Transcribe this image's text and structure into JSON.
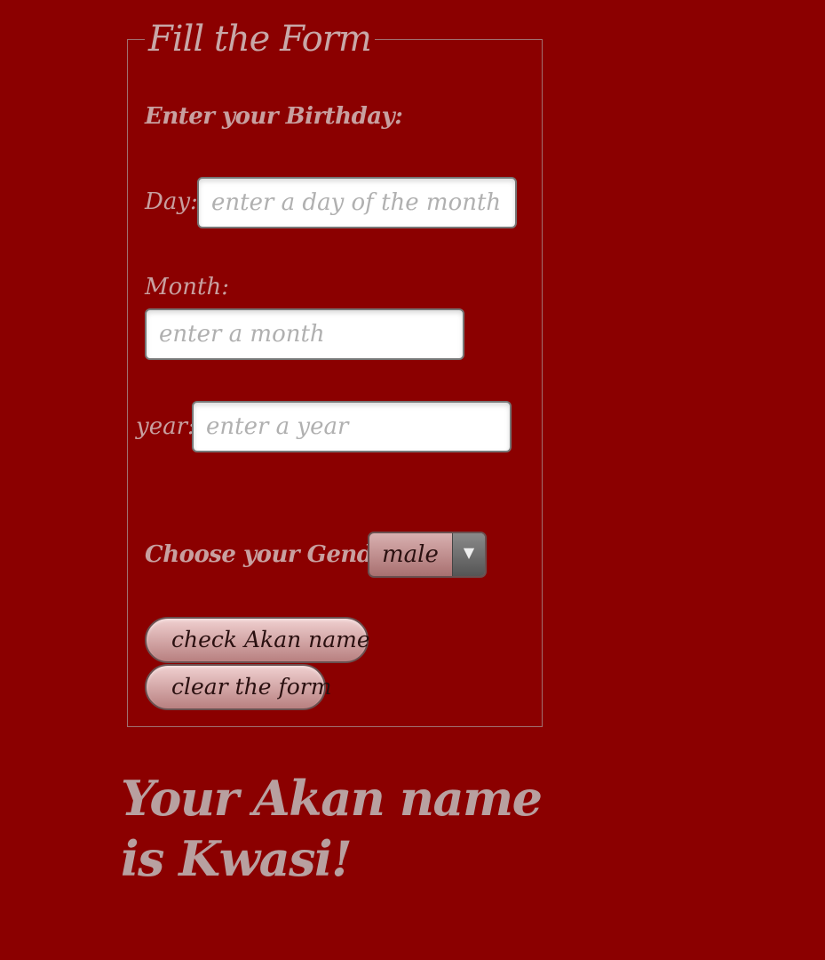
{
  "form": {
    "legend": "Fill the Form",
    "birthday_heading": "Enter your Birthday:",
    "day_label": "Day:",
    "day_placeholder": "enter a day of the month",
    "month_label": "Month:",
    "month_placeholder": "enter a month",
    "year_label": "year:",
    "year_placeholder": "enter a year",
    "gender_label": "Choose your Gender:",
    "gender_selected": "male",
    "check_button": "check Akan name",
    "clear_button": "clear the form"
  },
  "result": {
    "text": "Your Akan name is Kwasi!"
  },
  "icons": {
    "dropdown": "chevron-down-icon"
  },
  "colors": {
    "background": "#8b0000"
  }
}
